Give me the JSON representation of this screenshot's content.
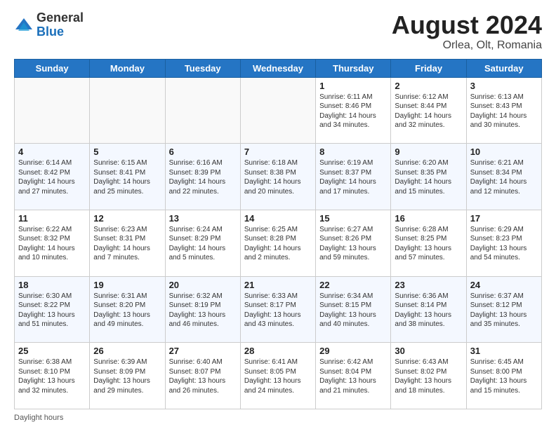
{
  "header": {
    "logo_general": "General",
    "logo_blue": "Blue",
    "month_title": "August 2024",
    "location": "Orlea, Olt, Romania"
  },
  "days_of_week": [
    "Sunday",
    "Monday",
    "Tuesday",
    "Wednesday",
    "Thursday",
    "Friday",
    "Saturday"
  ],
  "footer_text": "Daylight hours",
  "weeks": [
    [
      {
        "day": "",
        "info": ""
      },
      {
        "day": "",
        "info": ""
      },
      {
        "day": "",
        "info": ""
      },
      {
        "day": "",
        "info": ""
      },
      {
        "day": "1",
        "info": "Sunrise: 6:11 AM\nSunset: 8:46 PM\nDaylight: 14 hours and 34 minutes."
      },
      {
        "day": "2",
        "info": "Sunrise: 6:12 AM\nSunset: 8:44 PM\nDaylight: 14 hours and 32 minutes."
      },
      {
        "day": "3",
        "info": "Sunrise: 6:13 AM\nSunset: 8:43 PM\nDaylight: 14 hours and 30 minutes."
      }
    ],
    [
      {
        "day": "4",
        "info": "Sunrise: 6:14 AM\nSunset: 8:42 PM\nDaylight: 14 hours and 27 minutes."
      },
      {
        "day": "5",
        "info": "Sunrise: 6:15 AM\nSunset: 8:41 PM\nDaylight: 14 hours and 25 minutes."
      },
      {
        "day": "6",
        "info": "Sunrise: 6:16 AM\nSunset: 8:39 PM\nDaylight: 14 hours and 22 minutes."
      },
      {
        "day": "7",
        "info": "Sunrise: 6:18 AM\nSunset: 8:38 PM\nDaylight: 14 hours and 20 minutes."
      },
      {
        "day": "8",
        "info": "Sunrise: 6:19 AM\nSunset: 8:37 PM\nDaylight: 14 hours and 17 minutes."
      },
      {
        "day": "9",
        "info": "Sunrise: 6:20 AM\nSunset: 8:35 PM\nDaylight: 14 hours and 15 minutes."
      },
      {
        "day": "10",
        "info": "Sunrise: 6:21 AM\nSunset: 8:34 PM\nDaylight: 14 hours and 12 minutes."
      }
    ],
    [
      {
        "day": "11",
        "info": "Sunrise: 6:22 AM\nSunset: 8:32 PM\nDaylight: 14 hours and 10 minutes."
      },
      {
        "day": "12",
        "info": "Sunrise: 6:23 AM\nSunset: 8:31 PM\nDaylight: 14 hours and 7 minutes."
      },
      {
        "day": "13",
        "info": "Sunrise: 6:24 AM\nSunset: 8:29 PM\nDaylight: 14 hours and 5 minutes."
      },
      {
        "day": "14",
        "info": "Sunrise: 6:25 AM\nSunset: 8:28 PM\nDaylight: 14 hours and 2 minutes."
      },
      {
        "day": "15",
        "info": "Sunrise: 6:27 AM\nSunset: 8:26 PM\nDaylight: 13 hours and 59 minutes."
      },
      {
        "day": "16",
        "info": "Sunrise: 6:28 AM\nSunset: 8:25 PM\nDaylight: 13 hours and 57 minutes."
      },
      {
        "day": "17",
        "info": "Sunrise: 6:29 AM\nSunset: 8:23 PM\nDaylight: 13 hours and 54 minutes."
      }
    ],
    [
      {
        "day": "18",
        "info": "Sunrise: 6:30 AM\nSunset: 8:22 PM\nDaylight: 13 hours and 51 minutes."
      },
      {
        "day": "19",
        "info": "Sunrise: 6:31 AM\nSunset: 8:20 PM\nDaylight: 13 hours and 49 minutes."
      },
      {
        "day": "20",
        "info": "Sunrise: 6:32 AM\nSunset: 8:19 PM\nDaylight: 13 hours and 46 minutes."
      },
      {
        "day": "21",
        "info": "Sunrise: 6:33 AM\nSunset: 8:17 PM\nDaylight: 13 hours and 43 minutes."
      },
      {
        "day": "22",
        "info": "Sunrise: 6:34 AM\nSunset: 8:15 PM\nDaylight: 13 hours and 40 minutes."
      },
      {
        "day": "23",
        "info": "Sunrise: 6:36 AM\nSunset: 8:14 PM\nDaylight: 13 hours and 38 minutes."
      },
      {
        "day": "24",
        "info": "Sunrise: 6:37 AM\nSunset: 8:12 PM\nDaylight: 13 hours and 35 minutes."
      }
    ],
    [
      {
        "day": "25",
        "info": "Sunrise: 6:38 AM\nSunset: 8:10 PM\nDaylight: 13 hours and 32 minutes."
      },
      {
        "day": "26",
        "info": "Sunrise: 6:39 AM\nSunset: 8:09 PM\nDaylight: 13 hours and 29 minutes."
      },
      {
        "day": "27",
        "info": "Sunrise: 6:40 AM\nSunset: 8:07 PM\nDaylight: 13 hours and 26 minutes."
      },
      {
        "day": "28",
        "info": "Sunrise: 6:41 AM\nSunset: 8:05 PM\nDaylight: 13 hours and 24 minutes."
      },
      {
        "day": "29",
        "info": "Sunrise: 6:42 AM\nSunset: 8:04 PM\nDaylight: 13 hours and 21 minutes."
      },
      {
        "day": "30",
        "info": "Sunrise: 6:43 AM\nSunset: 8:02 PM\nDaylight: 13 hours and 18 minutes."
      },
      {
        "day": "31",
        "info": "Sunrise: 6:45 AM\nSunset: 8:00 PM\nDaylight: 13 hours and 15 minutes."
      }
    ]
  ]
}
